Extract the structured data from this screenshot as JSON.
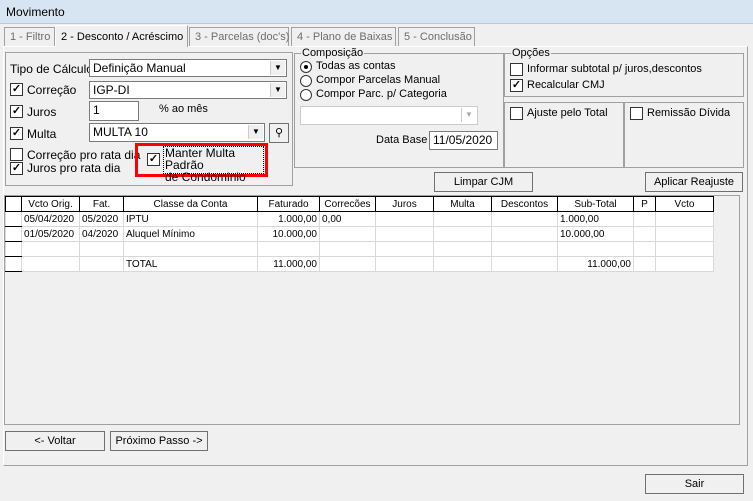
{
  "window": {
    "title": "Movimento"
  },
  "tabs": [
    {
      "label": "1 - Filtro"
    },
    {
      "label": "2 - Desconto / Acréscimo"
    },
    {
      "label": "3 - Parcelas (doc's)"
    },
    {
      "label": "4 - Plano de Baixas"
    },
    {
      "label": "5 - Conclusão"
    }
  ],
  "left": {
    "tipo_calculo_label": "Tipo de Cálculo",
    "tipo_calculo_value": "Definição Manual",
    "correcao_label": "Correção",
    "correcao_checked": true,
    "correcao_value": "IGP-DI",
    "juros_label": "Juros",
    "juros_checked": true,
    "juros_value": "1",
    "juros_unit": "% ao mês",
    "multa_label": "Multa",
    "multa_checked": true,
    "multa_value": "MULTA 10",
    "correcao_rata_label": "Correção pro rata dia",
    "correcao_rata_checked": false,
    "juros_rata_label": "Juros pro rata dia",
    "juros_rata_checked": true,
    "manter_multa_label_1": "Manter Multa Padrão",
    "manter_multa_label_2": "de Condominio",
    "manter_multa_checked": true,
    "highlight_color": "#ff0000"
  },
  "composicao": {
    "title": "Composição",
    "options": [
      {
        "label": "Todas as contas",
        "selected": true
      },
      {
        "label": "Compor Parcelas Manual",
        "selected": false
      },
      {
        "label": "Compor Parc. p/ Categoria",
        "selected": false
      }
    ],
    "category_value": "",
    "data_base_label": "Data Base",
    "data_base_value": "11/05/2020"
  },
  "opcoes": {
    "title": "Opções",
    "informar_label": "Informar subtotal p/ juros,descontos",
    "informar_checked": false,
    "recalcular_label": "Recalcular CMJ",
    "recalcular_checked": true
  },
  "ajuste_label": "Ajuste pelo Total",
  "ajuste_checked": false,
  "remissao_label": "Remissão Dívida",
  "remissao_checked": false,
  "buttons": {
    "limpar": "Limpar CJM",
    "aplicar": "Aplicar Reajuste",
    "voltar": "<- Voltar",
    "proximo": "Próximo Passo ->",
    "sair": "Sair"
  },
  "table": {
    "columns": [
      "Vcto Orig.",
      "Fat.",
      "Classe da Conta",
      "Faturado",
      "Correcões",
      "Juros",
      "Multa",
      "Descontos",
      "Sub-Total",
      "P",
      "Vcto"
    ],
    "rows": [
      [
        "05/04/2020",
        "05/2020",
        "IPTU",
        "1.000,00",
        "0,00",
        "",
        "",
        "",
        "1.000,00",
        "",
        ""
      ],
      [
        "01/05/2020",
        "04/2020",
        "Aluquel Mínimo",
        "10.000,00",
        "",
        "",
        "",
        "",
        "10.000,00",
        "",
        ""
      ],
      [
        "",
        "",
        "",
        "",
        "",
        "",
        "",
        "",
        "",
        "",
        ""
      ],
      [
        "",
        "",
        "TOTAL",
        "11.000,00",
        "",
        "",
        "",
        "",
        "11.000,00",
        "",
        ""
      ]
    ]
  }
}
